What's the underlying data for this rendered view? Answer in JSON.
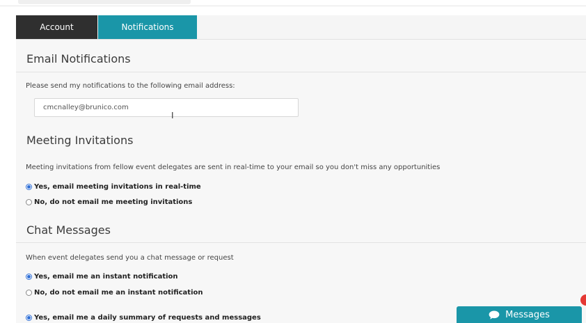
{
  "tabs": {
    "account": "Account",
    "notifications": "Notifications"
  },
  "email_section": {
    "title": "Email Notifications",
    "description": "Please send my notifications to the following email address:",
    "email_value": "cmcnalley@brunico.com"
  },
  "meetings_section": {
    "title": "Meeting Invitations",
    "description": "Meeting invitations from fellow event delegates are sent in real-time to your email so you don't miss any opportunities",
    "options": [
      {
        "label": "Yes, email meeting invitations in real-time",
        "checked": true
      },
      {
        "label": "No, do not email me meeting invitations",
        "checked": false
      }
    ]
  },
  "chat_section": {
    "title": "Chat Messages",
    "description": "When event delegates send you a chat message or request",
    "options": [
      {
        "label": "Yes, email me an instant notification",
        "checked": true
      },
      {
        "label": "No, do not email me an instant notification",
        "checked": false
      }
    ],
    "summary_option": {
      "label": "Yes, email me a daily summary of requests and messages",
      "checked": true
    }
  },
  "messages_button": {
    "label": "Messages",
    "icon": "chat-bubble-icon"
  },
  "colors": {
    "accent": "#1a96a8",
    "dark_tab": "#2f2f2f",
    "radio_checked": "#2f6fd6",
    "badge": "#e53935"
  }
}
